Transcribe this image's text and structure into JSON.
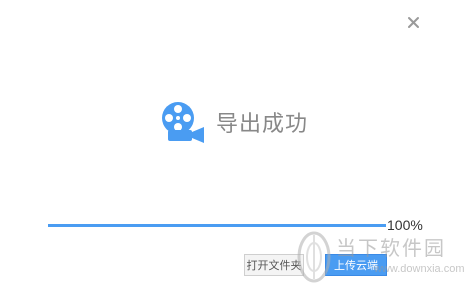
{
  "dialog": {
    "close_icon": "close-icon",
    "status_icon": "video-camera-icon",
    "status_text": "导出成功",
    "progress": {
      "value": 1.0,
      "label": "100%"
    },
    "buttons": {
      "open_file_label": "打开文件夹",
      "upload_cloud_label": "上传云端"
    },
    "watermark": {
      "title": "当下软件园",
      "url": "www.downxia.com"
    }
  },
  "colors": {
    "accent": "#4a9cf2",
    "text_gray": "#888888",
    "close_gray": "#9a9a9a"
  }
}
